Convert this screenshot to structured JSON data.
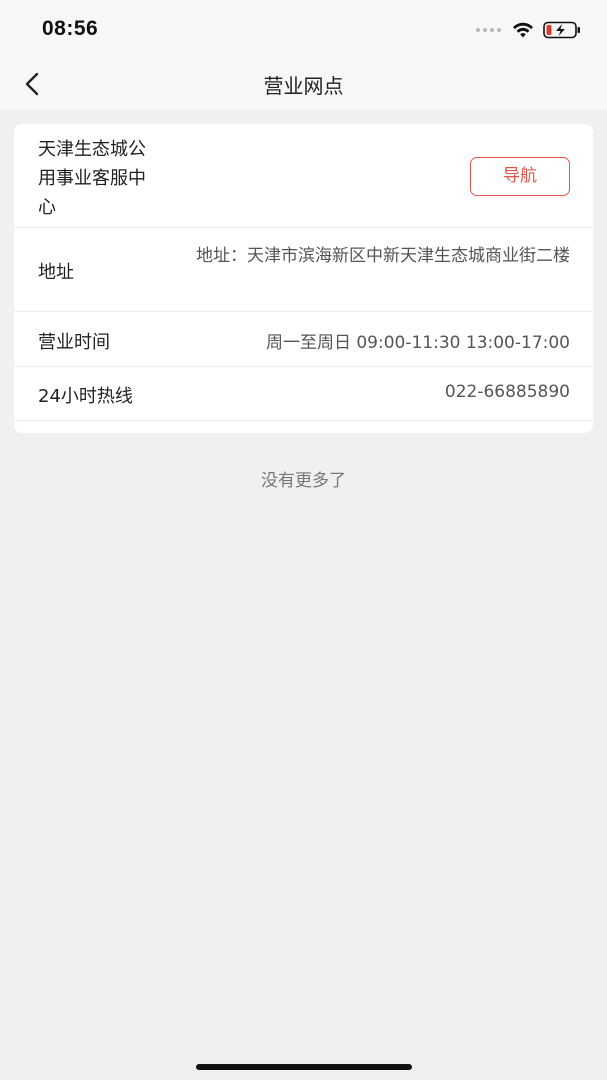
{
  "status_bar": {
    "time": "08:56"
  },
  "nav": {
    "title": "营业网点",
    "back_icon": "chevron-left-icon"
  },
  "branch": {
    "name": "天津生态城公用事业客服中心",
    "navigate_label": "导航",
    "accent_color": "#e0564a",
    "rows": {
      "address": {
        "label": "地址",
        "value": "地址：天津市滨海新区中新天津生态城商业街二楼"
      },
      "hours": {
        "label": "营业时间",
        "value": "周一至周日 09:00-11:30 13:00-17:00"
      },
      "hotline": {
        "label": "24小时热线",
        "value": "022-66885890"
      }
    }
  },
  "footer": {
    "no_more_text": "没有更多了"
  }
}
